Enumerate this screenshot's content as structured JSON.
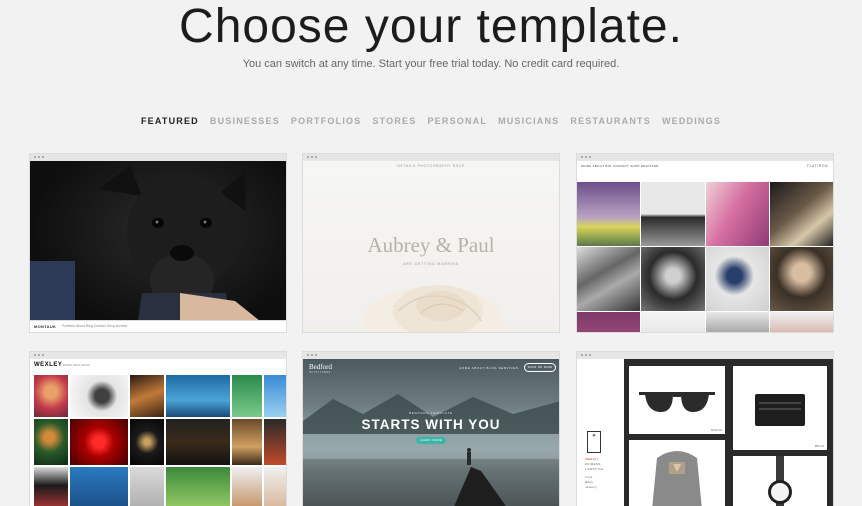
{
  "header": {
    "title": "Choose your template.",
    "subtitle": "You can switch at any time. Start your free trial today. No credit card required."
  },
  "categories": [
    {
      "label": "FEATURED",
      "active": true
    },
    {
      "label": "BUSINESSES",
      "active": false
    },
    {
      "label": "PORTFOLIOS",
      "active": false
    },
    {
      "label": "STORES",
      "active": false
    },
    {
      "label": "PERSONAL",
      "active": false
    },
    {
      "label": "MUSICIANS",
      "active": false
    },
    {
      "label": "RESTAURANTS",
      "active": false
    },
    {
      "label": "WEDDINGS",
      "active": false
    }
  ],
  "templates": {
    "dog": {
      "brand": "MONTAUK",
      "links": "Portfolio   About   Blog   Contact   Shop   Archive"
    },
    "aubrey": {
      "nav": "DETAILS     PHOTOGRAPHY     RSVP",
      "title": "Aubrey & Paul",
      "subtitle": "ARE GETTING MARRIED"
    },
    "flatiron": {
      "nav": "WORK   ABOUT   BIO   CONTACT   SHOP   REGISTER",
      "brand": "FLATIRON"
    },
    "wexley": {
      "brand": "WEXLEY",
      "nav": "WORK   INFO   SHOP"
    },
    "bedford": {
      "brand": "Bedford",
      "brand_sub": "OUTFITTERS",
      "nav": "HOME    ABOUT    BLOG    SERVICES",
      "button": "SIGN UP NOW",
      "small": "BEDFORD TEMPLATE",
      "title": "STARTS WITH YOU",
      "cta": "LEARN MORE"
    },
    "shop": {
      "categories": [
        "WEEKLY",
        "WOMENS",
        "LIFESTYLE"
      ],
      "subcategories": [
        "Tops",
        "Bags",
        "Jewelry"
      ],
      "prices": [
        "$180.00",
        "$85.00"
      ]
    }
  }
}
